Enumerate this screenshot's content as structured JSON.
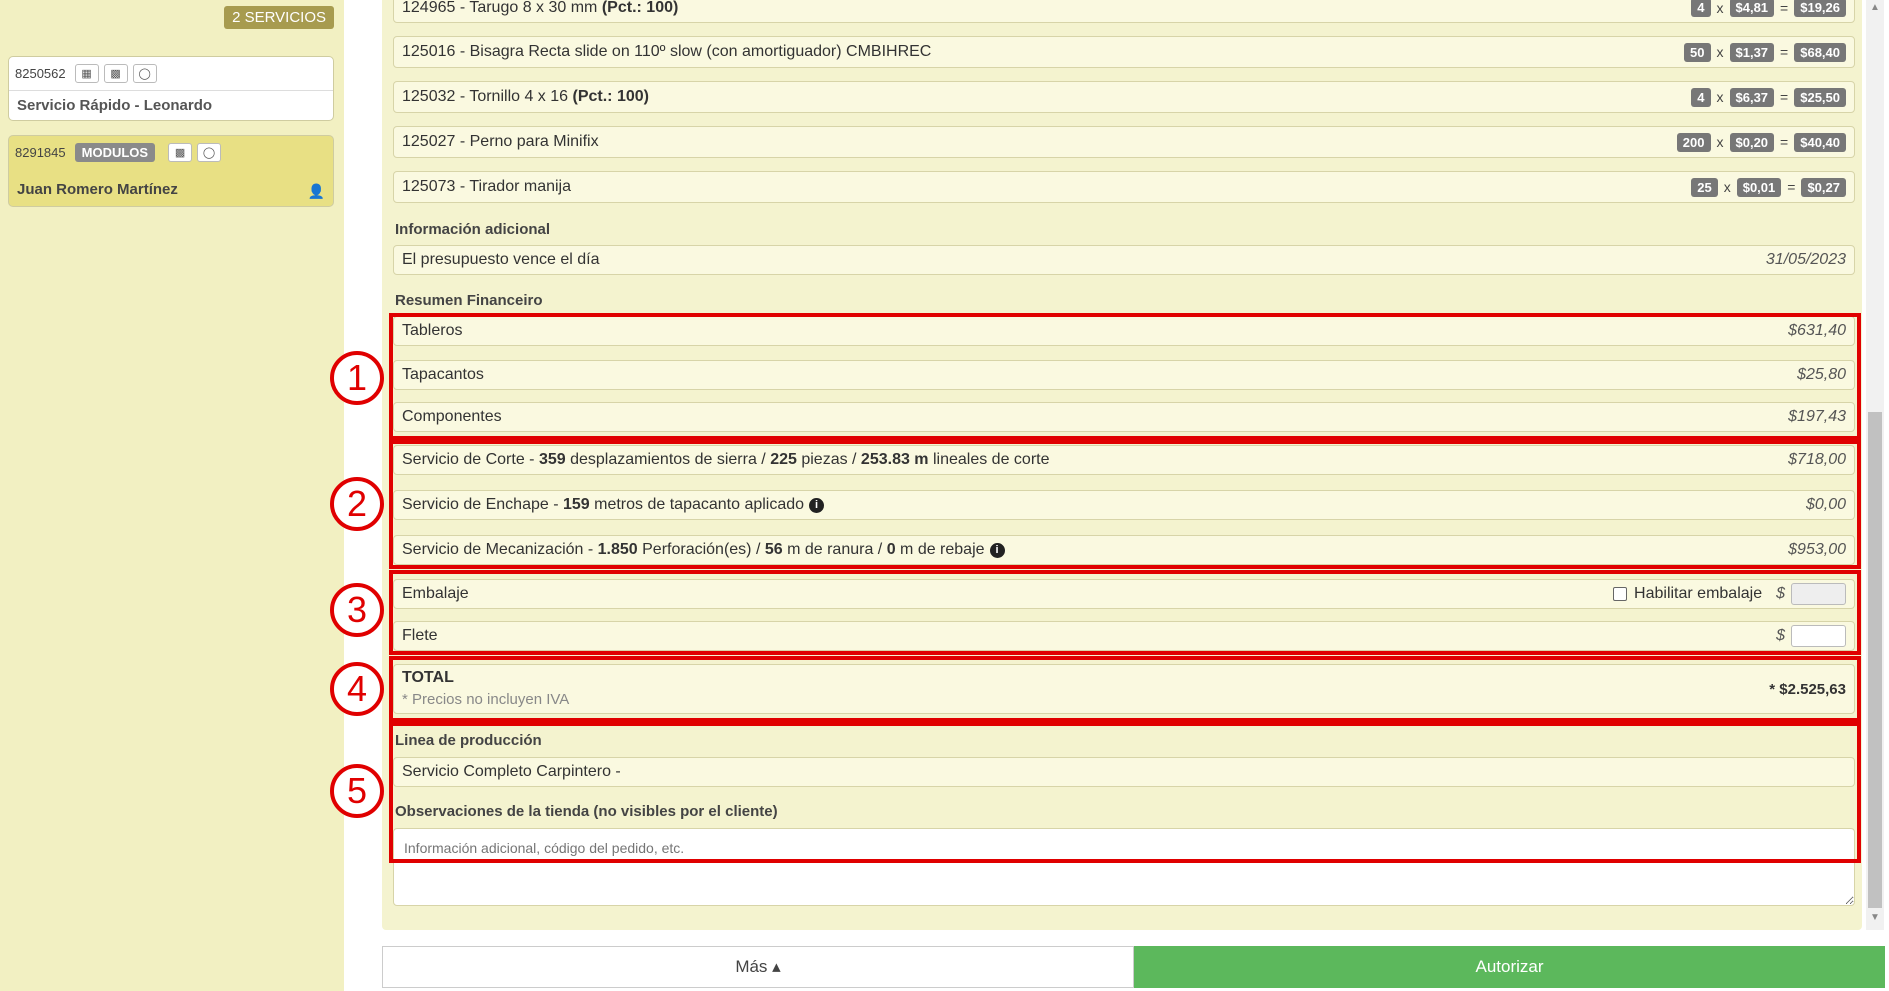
{
  "sidebar": {
    "services_count": "2 SERVICIOS",
    "orders": [
      {
        "id": "8250562",
        "name": "Servicio Rápido - Leonardo"
      },
      {
        "id": "8291845",
        "tag": "MODULOS",
        "name": "Juan Romero Martínez"
      }
    ]
  },
  "components": [
    {
      "code": "124965",
      "desc": "Tarugo 8 x 30 mm",
      "pack": "(Pct.: 100)",
      "qty": "4",
      "price": "$4,81",
      "total": "$19,26"
    },
    {
      "code": "125016",
      "desc": "Bisagra Recta slide on 110º slow (con amortiguador) CMBIHREC",
      "pack": "",
      "qty": "50",
      "price": "$1,37",
      "total": "$68,40"
    },
    {
      "code": "125032",
      "desc": "Tornillo 4 x 16",
      "pack": "(Pct.: 100)",
      "qty": "4",
      "price": "$6,37",
      "total": "$25,50"
    },
    {
      "code": "125027",
      "desc": "Perno para Minifix",
      "pack": "",
      "qty": "200",
      "price": "$0,20",
      "total": "$40,40"
    },
    {
      "code": "125073",
      "desc": "Tirador manija",
      "pack": "",
      "qty": "25",
      "price": "$0,01",
      "total": "$0,27"
    }
  ],
  "ops": {
    "times": "x",
    "equals": "=",
    "dash": "-"
  },
  "info": {
    "label": "Información adicional",
    "text": "El presupuesto vence el día",
    "date": "31/05/2023"
  },
  "summary": {
    "label": "Resumen Financeiro",
    "tableros": {
      "label": "Tableros",
      "amount": "$631,40"
    },
    "tapacantos": {
      "label": "Tapacantos",
      "amount": "$25,80"
    },
    "componentes": {
      "label": "Componentes",
      "amount": "$197,43"
    },
    "corte": {
      "prefix": "Servicio de Corte - ",
      "n1": "359",
      "t1": " desplazamientos de sierra / ",
      "n2": "225",
      "t2": " piezas / ",
      "n3": "253.83 m",
      "t3": " lineales de corte",
      "amount": "$718,00"
    },
    "enchape": {
      "prefix": "Servicio de Enchape - ",
      "n1": "159",
      "t1": " metros de tapacanto aplicado",
      "amount": "$0,00"
    },
    "mecanizacion": {
      "prefix": "Servicio de Mecanización - ",
      "n1": "1.850",
      "t1": " Perforación(es) / ",
      "n2": "56",
      "t2": " m de ranura / ",
      "n3": "0",
      "t3": " m de rebaje",
      "amount": "$953,00"
    },
    "embalaje": {
      "label": "Embalaje",
      "checkbox_label": "Habilitar embalaje",
      "currency": "$"
    },
    "flete": {
      "label": "Flete",
      "currency": "$"
    },
    "total": {
      "label": "TOTAL",
      "note": "* Precios no incluyen IVA",
      "amount": "* $2.525,63"
    }
  },
  "production": {
    "label": "Linea de producción",
    "value": "Servicio Completo Carpintero -"
  },
  "observations": {
    "label": "Observaciones de la tienda (no visibles por el cliente)",
    "placeholder": "Información adicional, código del pedido, etc."
  },
  "annotations": [
    "1",
    "2",
    "3",
    "4",
    "5"
  ],
  "footer": {
    "more": "Más ▴",
    "authorize": "Autorizar"
  },
  "colors": {
    "highlight": "#e00000",
    "authorize": "#5cb85c",
    "panel": "#f4f3cf"
  }
}
